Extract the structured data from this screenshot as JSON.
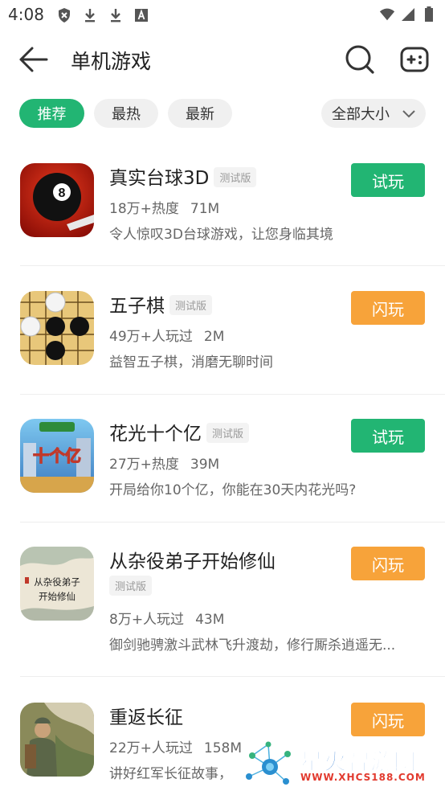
{
  "status_bar": {
    "time": "4:08"
  },
  "header": {
    "title": "单机游戏"
  },
  "filters": {
    "recommended": "推荐",
    "hottest": "最热",
    "newest": "最新",
    "size": "全部大小"
  },
  "games": [
    {
      "name": "真实台球3D",
      "badge": "测试版",
      "stat1": "18万+热度",
      "size": "71M",
      "desc": "令人惊叹3D台球游戏，让您身临其境",
      "action": "试玩",
      "action_color": "#22b573"
    },
    {
      "name": "五子棋",
      "badge": "测试版",
      "stat1": "49万+人玩过",
      "size": "2M",
      "desc": "益智五子棋，消磨无聊时间",
      "action": "闪玩",
      "action_color": "#f7a33a"
    },
    {
      "name": "花光十个亿",
      "badge": "测试版",
      "stat1": "27万+热度",
      "size": "39M",
      "desc": "开局给你10个亿，你能在30天内花光吗?",
      "action": "试玩",
      "action_color": "#22b573",
      "icon_text": "十个亿"
    },
    {
      "name": "从杂役弟子开始修仙",
      "badge": "测试版",
      "stat1": "8万+人玩过",
      "size": "43M",
      "desc": "御剑驰骋激斗武林飞升渡劫，修行厮杀逍遥无...",
      "action": "闪玩",
      "action_color": "#f7a33a",
      "icon_text_1": "从杂役弟子",
      "icon_text_2": "开始修仙"
    },
    {
      "name": "重返长征",
      "stat1": "22万+人玩过",
      "size": "158M",
      "desc": "讲好红军长征故事，",
      "action": "闪玩",
      "action_color": "#f7a33a"
    }
  ],
  "watermark": {
    "title": "星火智游网",
    "url": "WWW.XHCS188.COM"
  }
}
